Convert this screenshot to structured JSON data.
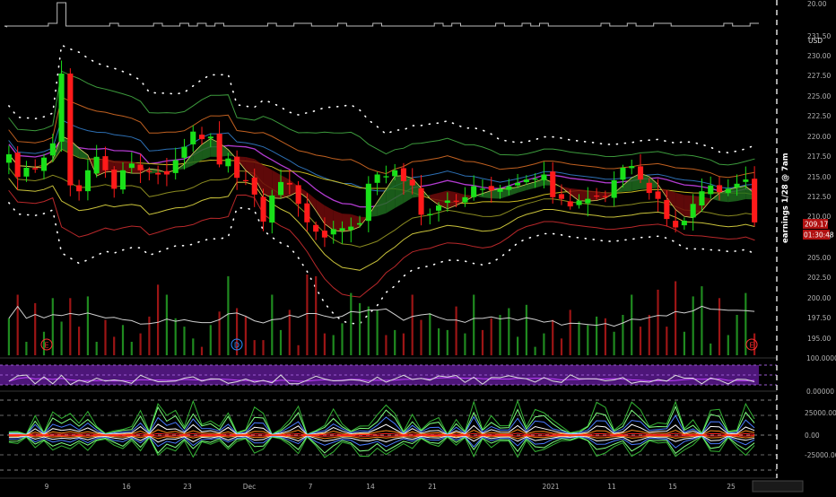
{
  "chart_data": [
    {
      "type": "candlestick",
      "panel": "price",
      "y_axis_labels": [
        "20.00",
        "231.50",
        "230.00",
        "227.50",
        "225.00",
        "222.50",
        "220.00",
        "217.50",
        "215.00",
        "212.50",
        "210.00",
        "207.50",
        "205.00",
        "202.50",
        "200.00",
        "197.50",
        "195.00"
      ],
      "ylim": [
        193.5,
        234
      ],
      "x_tick_labels": [
        "9",
        "16",
        "23",
        "Dec",
        "7",
        "14",
        "21",
        "2021",
        "11",
        "15",
        "25"
      ],
      "last_price": "209.17",
      "countdown": "01:30:48",
      "event_annotation": "earnings 1/28 @ 7am",
      "currency": "USD",
      "series": [
        {
          "name": "",
          "close_values": [
            217.2,
            214.5,
            215.6,
            215.4,
            216.8,
            218.5,
            226.8,
            213.5,
            212.8,
            215.3,
            216.9,
            215.3,
            213.1,
            215.3,
            216.1,
            215.3,
            215.2,
            214.8,
            214.8,
            216.5,
            218.1,
            219.9,
            219.0,
            219.3,
            216.0,
            216.7,
            214.4,
            214.1,
            212.4,
            209.2,
            212.3,
            213.9,
            213.6,
            211.3,
            209.1,
            208.0,
            207.3,
            208.3,
            208.4,
            208.6,
            209.0,
            213.7,
            214.8,
            214.6,
            215.3,
            214.0,
            213.5,
            210.0,
            210.1,
            211.1,
            211.7,
            211.6,
            212.1,
            213.4,
            213.1,
            212.9,
            213.1,
            213.4,
            213.8,
            214.2,
            214.3,
            214.8,
            212.1,
            211.9,
            211.0,
            211.7,
            211.9,
            212.2,
            212.1,
            214.1,
            215.6,
            215.8,
            214.2,
            212.6,
            211.9,
            209.5,
            208.5,
            209.3,
            211.3,
            212.8,
            213.5,
            212.7,
            213.1,
            213.7,
            214.2,
            209.1
          ]
        }
      ]
    },
    {
      "type": "bar",
      "panel": "volume",
      "series": [
        {
          "name": "",
          "values": [
            22,
            36,
            8,
            31,
            14,
            34,
            20,
            34,
            17,
            35,
            8,
            21,
            11,
            18,
            8,
            13,
            23,
            42,
            36,
            22,
            17,
            10,
            5,
            18,
            26,
            47,
            28,
            23,
            9,
            9,
            36,
            15,
            27,
            6,
            48,
            47,
            13,
            12,
            19,
            37,
            31,
            29,
            27,
            12,
            15,
            13,
            36,
            21,
            25,
            16,
            15,
            29,
            13,
            36,
            15,
            22,
            24,
            28,
            11,
            30,
            5,
            13,
            21,
            10,
            27,
            20,
            18,
            23,
            22,
            14,
            24,
            36,
            17,
            24,
            39,
            17,
            44,
            14,
            35,
            41,
            7,
            34,
            12,
            24,
            37,
            13
          ]
        }
      ]
    },
    {
      "type": "line",
      "panel": "oscillator",
      "y_axis_labels": [
        "100.00000",
        "0.00000"
      ],
      "ylim": [
        0,
        100
      ],
      "series": [
        {
          "name": "",
          "values": [
            20,
            44,
            48,
            9,
            40,
            9,
            47,
            5,
            25,
            15,
            34,
            21,
            26,
            21,
            11,
            47,
            31,
            18,
            19,
            21,
            34,
            40,
            21,
            31,
            30,
            11,
            18,
            30,
            16,
            24,
            13,
            48,
            9,
            9,
            25,
            43,
            30,
            22,
            23,
            27,
            24,
            14,
            39,
            16,
            31,
            47,
            28,
            33,
            25,
            44,
            39,
            46,
            15,
            38,
            7,
            37,
            36,
            45,
            36,
            31,
            16,
            37,
            21,
            15,
            49,
            31,
            31,
            31,
            22,
            26,
            37,
            11,
            19,
            16,
            28,
            21,
            47,
            34,
            34,
            9,
            35,
            25,
            8,
            29,
            28,
            18
          ]
        }
      ]
    },
    {
      "type": "line",
      "panel": "lower",
      "y_axis_labels": [
        "25000.00",
        "0.00",
        "-25000.00"
      ],
      "ylim": [
        -40000,
        40000
      ],
      "series": [
        {
          "name": "",
          "values": [
            -4000,
            -4000,
            -1000,
            10000,
            -3000,
            11000,
            8000,
            11000,
            6000,
            12000,
            5000,
            -2000,
            -5000,
            -7000,
            4000,
            13000,
            2000,
            17000,
            9000,
            12000,
            4000,
            16000,
            6000,
            7000,
            4000,
            12000,
            -3000,
            3000,
            13000,
            12000,
            -1000,
            3000,
            8000,
            15000,
            -1000,
            -6000,
            -11000,
            12000,
            6000,
            -5000,
            -10000,
            -10000,
            10000,
            17000,
            11000,
            -4000,
            10000,
            3000,
            7000,
            8000,
            -1000,
            8000,
            2000,
            17000,
            3000,
            9000,
            5000,
            5000,
            17000,
            4000,
            13000,
            12000,
            7000,
            4000,
            -3000,
            2000,
            5000,
            15000,
            14000,
            -6000,
            6000,
            17000,
            13000,
            5000,
            6000,
            6000,
            18000,
            -7000,
            7000,
            1000,
            14000,
            13000,
            2000,
            -6000,
            15000,
            8000
          ]
        }
      ]
    }
  ]
}
